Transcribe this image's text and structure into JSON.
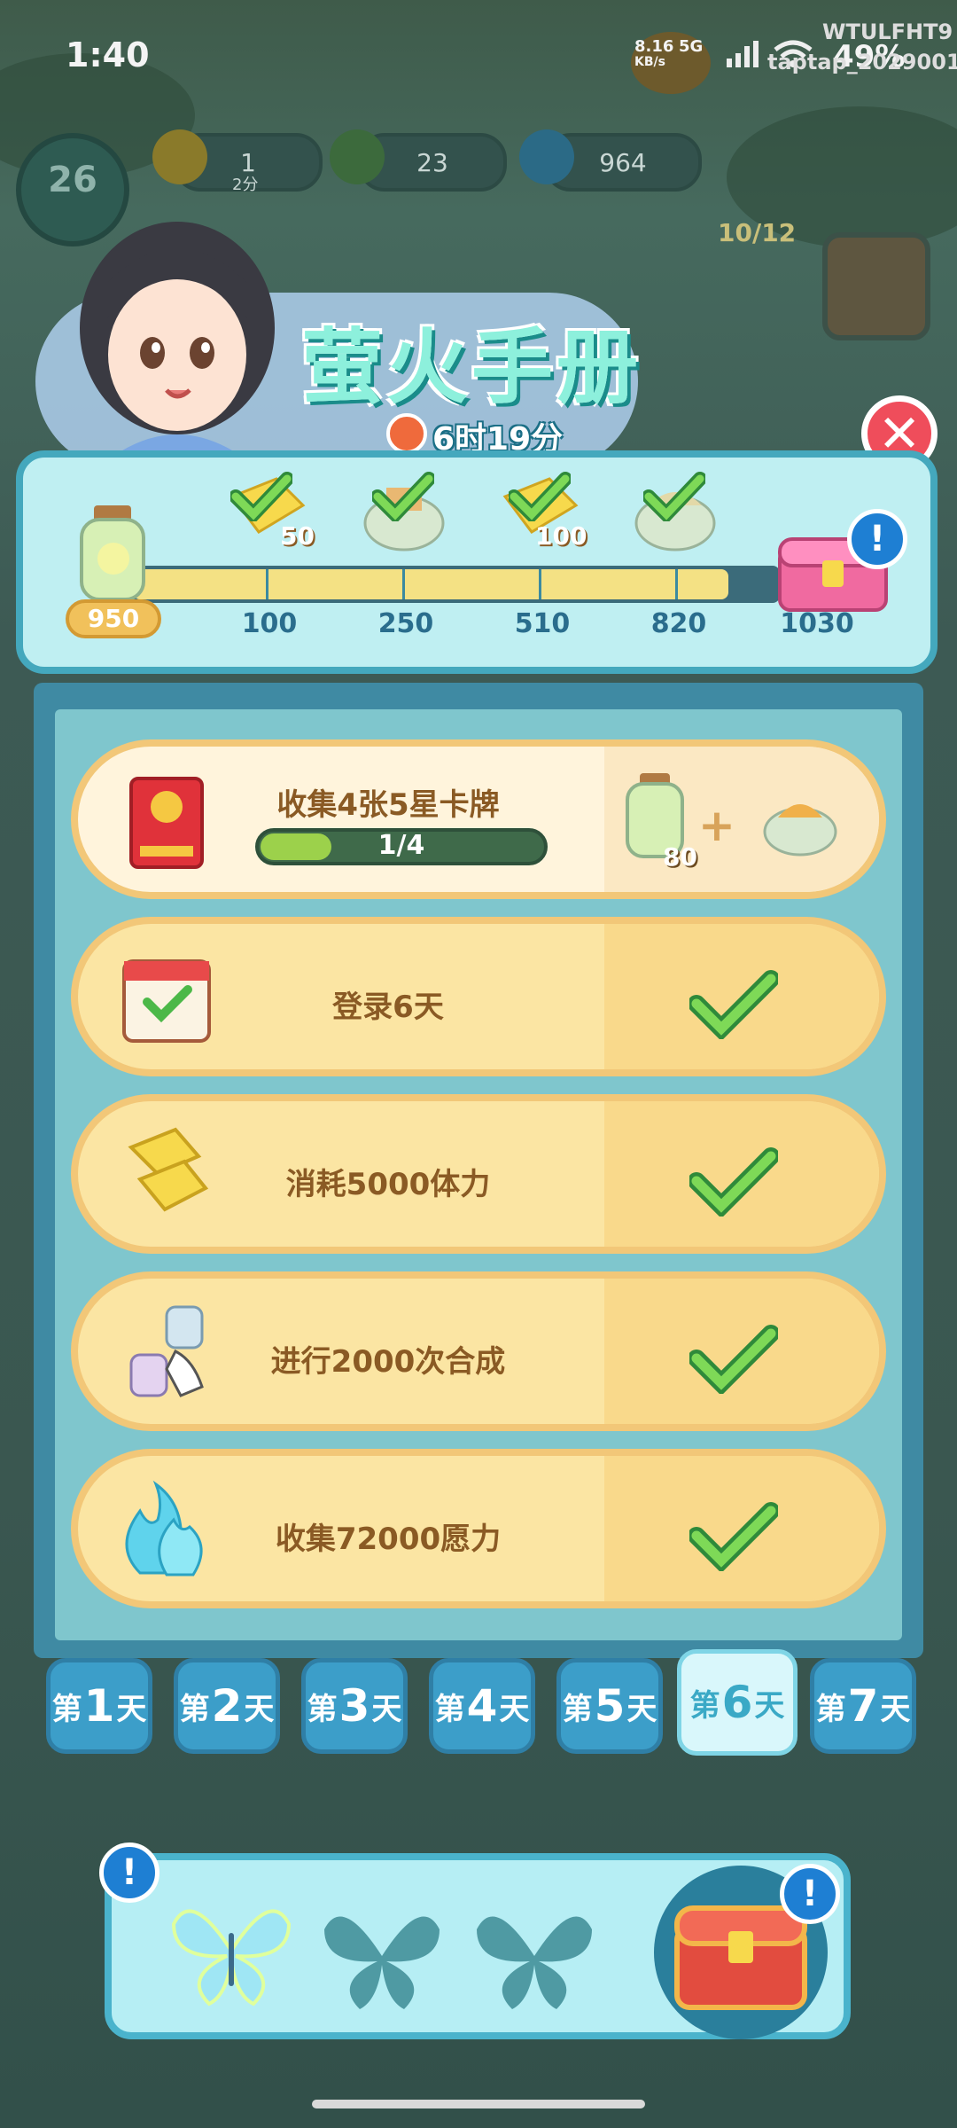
{
  "status_bar": {
    "time": "1:40",
    "net_speed": "8.16",
    "net_unit": "KB/s",
    "net_type": "5G",
    "battery": "49%",
    "watermark_line1": "WTULFHT9",
    "watermark_line2": "taptap_2029001"
  },
  "resources": {
    "level": "26",
    "energy": "1",
    "energy_sub": "2分",
    "coins": "23",
    "wish_power": "964",
    "progress_counter": "10/12"
  },
  "header": {
    "title": "萤火手册",
    "timer": "6时19分"
  },
  "milestones": {
    "current_points": "950",
    "fill_fraction": 0.92,
    "items": [
      {
        "threshold": "100",
        "reward_qty": "50",
        "reward_icon": "energy-icon",
        "claimed": true
      },
      {
        "threshold": "250",
        "reward_qty": "",
        "reward_icon": "item-bundle-icon",
        "claimed": true
      },
      {
        "threshold": "510",
        "reward_qty": "100",
        "reward_icon": "energy-icon",
        "claimed": true
      },
      {
        "threshold": "820",
        "reward_qty": "",
        "reward_icon": "item-bundle-icon",
        "claimed": true
      },
      {
        "threshold": "1030",
        "reward_qty": "",
        "reward_icon": "treasure-chest-icon",
        "claimed": false
      }
    ]
  },
  "tasks": [
    {
      "label": "收集4张5星卡牌",
      "progress": "1/4",
      "progress_fraction": 0.25,
      "reward_qty": "80",
      "done": false,
      "icon": "red-card-pack-icon"
    },
    {
      "label": "登录6天",
      "done": true,
      "icon": "calendar-icon"
    },
    {
      "label": "消耗5000体力",
      "done": true,
      "icon": "energy-bolt-icon"
    },
    {
      "label": "进行2000次合成",
      "done": true,
      "icon": "merge-hand-icon"
    },
    {
      "label": "收集72000愿力",
      "done": true,
      "icon": "blue-flame-icon"
    }
  ],
  "day_tabs": [
    {
      "prefix": "第",
      "num": "1",
      "suffix": "天",
      "selected": false
    },
    {
      "prefix": "第",
      "num": "2",
      "suffix": "天",
      "selected": false
    },
    {
      "prefix": "第",
      "num": "3",
      "suffix": "天",
      "selected": false
    },
    {
      "prefix": "第",
      "num": "4",
      "suffix": "天",
      "selected": false
    },
    {
      "prefix": "第",
      "num": "5",
      "suffix": "天",
      "selected": false
    },
    {
      "prefix": "第",
      "num": "6",
      "suffix": "天",
      "selected": true
    },
    {
      "prefix": "第",
      "num": "7",
      "suffix": "天",
      "selected": false
    }
  ],
  "bottom": {
    "alert": "!",
    "butterflies_collected": 1,
    "butterflies_total": 3
  },
  "colors": {
    "accent": "#44a8bd",
    "check_green": "#7ed957",
    "label_brown": "#8a5a24",
    "close_red": "#ef4d5b"
  }
}
